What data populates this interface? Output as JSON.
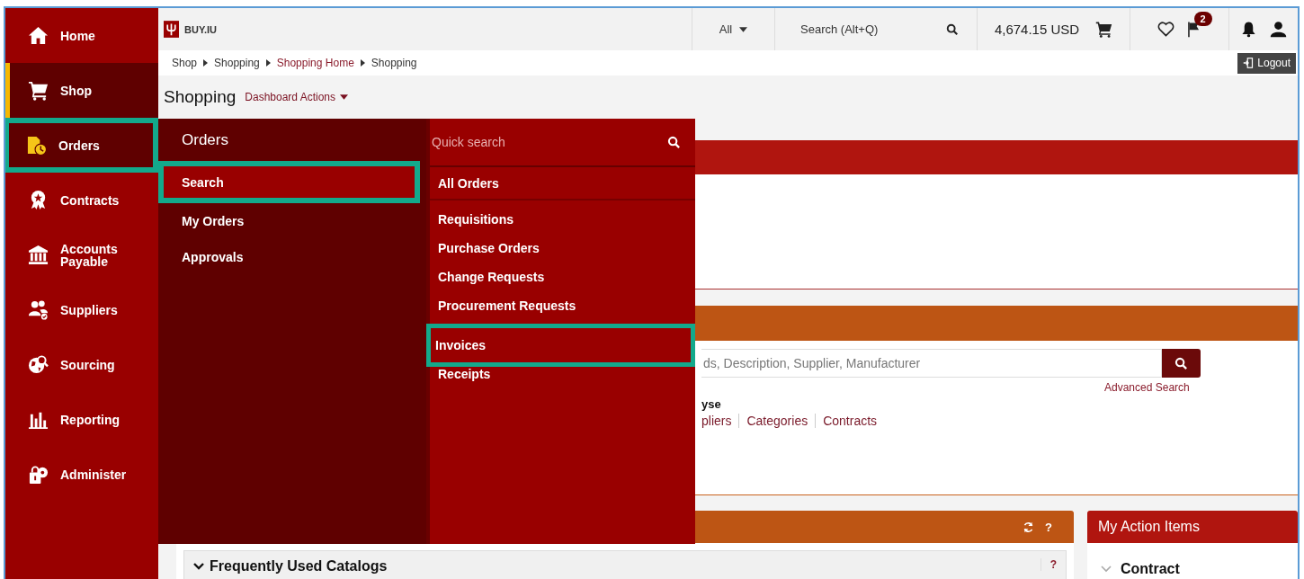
{
  "header": {
    "logo": "BUY.IU",
    "scope": "All",
    "search": {
      "placeholder": "Search (Alt+Q)"
    },
    "cart_total": "4,674.15 USD",
    "notification_count": "2"
  },
  "sidebar": {
    "items": [
      {
        "label": "Home",
        "selected": false,
        "expanded": false,
        "highlighted": false
      },
      {
        "label": "Shop",
        "selected": true,
        "expanded": false,
        "highlighted": false
      },
      {
        "label": "Orders",
        "selected": false,
        "expanded": true,
        "highlighted": true
      },
      {
        "label": "Contracts",
        "selected": false,
        "expanded": false,
        "highlighted": false
      },
      {
        "label": "Accounts Payable",
        "selected": false,
        "expanded": false,
        "highlighted": false
      },
      {
        "label": "Suppliers",
        "selected": false,
        "expanded": false,
        "highlighted": false
      },
      {
        "label": "Sourcing",
        "selected": false,
        "expanded": false,
        "highlighted": false
      },
      {
        "label": "Reporting",
        "selected": false,
        "expanded": false,
        "highlighted": false
      },
      {
        "label": "Administer",
        "selected": false,
        "expanded": false,
        "highlighted": false
      }
    ]
  },
  "breadcrumb": [
    {
      "label": "Shop",
      "link": false
    },
    {
      "label": "Shopping",
      "link": false
    },
    {
      "label": "Shopping Home",
      "link": true
    },
    {
      "label": "Shopping",
      "link": false
    }
  ],
  "logout": "Logout",
  "page": {
    "title": "Shopping",
    "actions": "Dashboard Actions"
  },
  "flyout": {
    "title": "Orders",
    "items": [
      {
        "label": "Search",
        "selected": true,
        "highlighted": true
      },
      {
        "label": "My Orders",
        "selected": false,
        "highlighted": false
      },
      {
        "label": "Approvals",
        "selected": false,
        "highlighted": false
      }
    ],
    "quick_search": {
      "placeholder": "Quick search"
    },
    "links": [
      {
        "label": "All Orders",
        "highlighted": false
      },
      {
        "label": "Requisitions",
        "highlighted": false
      },
      {
        "label": "Purchase Orders",
        "highlighted": false
      },
      {
        "label": "Change Requests",
        "highlighted": false
      },
      {
        "label": "Procurement Requests",
        "highlighted": false
      },
      {
        "label": "Invoices",
        "highlighted": true
      },
      {
        "label": "Receipts",
        "highlighted": false
      }
    ]
  },
  "background": {
    "search": {
      "placeholder": "ds, Description, Supplier, Manufacturer"
    },
    "advanced_search": "Advanced Search",
    "browse_heading": "yse",
    "browse_links": [
      "pliers",
      "Categories",
      "Contracts"
    ],
    "panel_help": "?",
    "catalog_section": "Frequently Used Catalogs",
    "catalog_help": "?",
    "action_items": {
      "title": "My Action Items",
      "first": "Contract"
    }
  }
}
